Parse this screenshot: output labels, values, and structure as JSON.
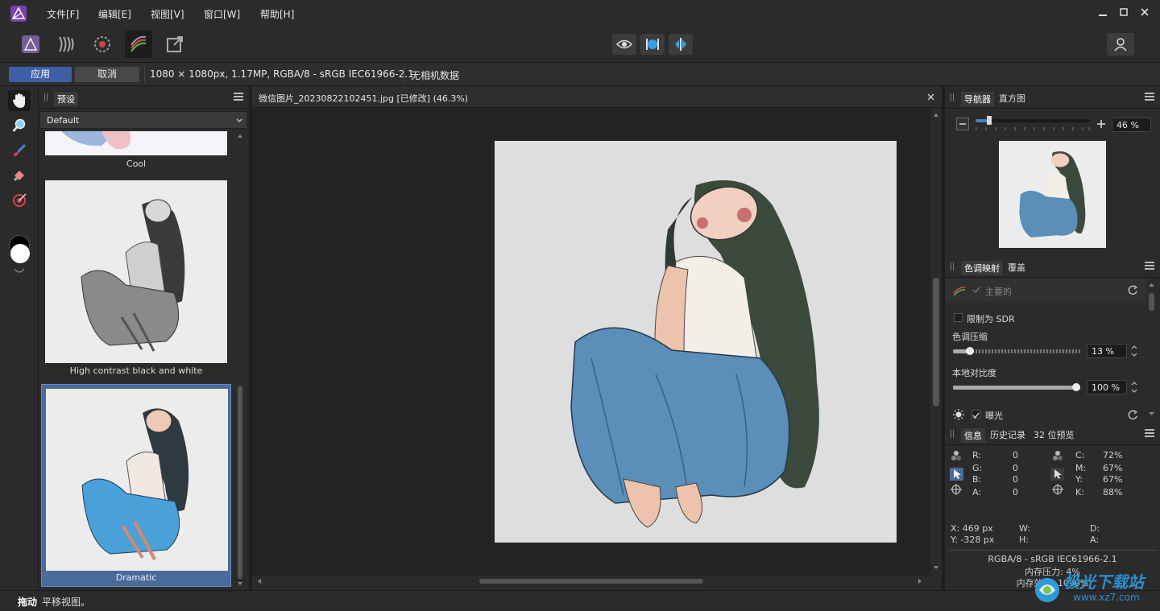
{
  "menu": {
    "items": [
      "文件[F]",
      "编辑[E]",
      "视图[V]",
      "窗口[W]",
      "帮助[H]"
    ]
  },
  "context": {
    "apply": "应用",
    "cancel": "取消",
    "doc_info": "1080 × 1080px, 1.17MP, RGBA/8 - sRGB IEC61966-2.1",
    "camera": "无相机数据"
  },
  "presets": {
    "tab": "预设",
    "dropdown": "Default",
    "items": [
      {
        "label": "Cool"
      },
      {
        "label": "High contrast black and white"
      },
      {
        "label": "Dramatic"
      }
    ]
  },
  "canvas": {
    "tab_title": "微信图片_20230822102451.jpg [已修改] (46.3%)"
  },
  "navigator": {
    "tabs": [
      "导航器",
      "直方图"
    ],
    "zoom": "46 %",
    "zoom_fraction": 0.12
  },
  "tonemap": {
    "tabs": [
      "色调映射",
      "覆盖"
    ],
    "section": "主要的",
    "limit_sdr": "限制为 SDR",
    "compress_label": "色调压缩",
    "compress_value": "13 %",
    "compress_fraction": 0.13,
    "local_label": "本地对比度",
    "local_value": "100 %",
    "local_fraction": 1.0,
    "exposure": "曝光"
  },
  "info": {
    "tabs": [
      "信息",
      "历史记录",
      "32 位预览"
    ],
    "rgb": [
      {
        "k": "R:",
        "v": "0"
      },
      {
        "k": "G:",
        "v": "0"
      },
      {
        "k": "B:",
        "v": "0"
      },
      {
        "k": "A:",
        "v": "0"
      }
    ],
    "cmyk": [
      {
        "k": "C:",
        "v": "72%"
      },
      {
        "k": "M:",
        "v": "67%"
      },
      {
        "k": "Y:",
        "v": "67%"
      },
      {
        "k": "K:",
        "v": "88%"
      }
    ],
    "x": "X: 469 px",
    "y": "Y: -328 px",
    "w": "W:",
    "h": "H:",
    "d": "D:",
    "a": "A:",
    "profile": "RGBA/8 - sRGB IEC61966-2.1",
    "mem_pressure": "内存压力: 4%",
    "mem_eff": "内存效率: 1090%"
  },
  "status": {
    "bold": "拖动",
    "text": "平移视图。"
  },
  "watermark": {
    "text": "极光下载站",
    "url": "www.xz7.com"
  }
}
